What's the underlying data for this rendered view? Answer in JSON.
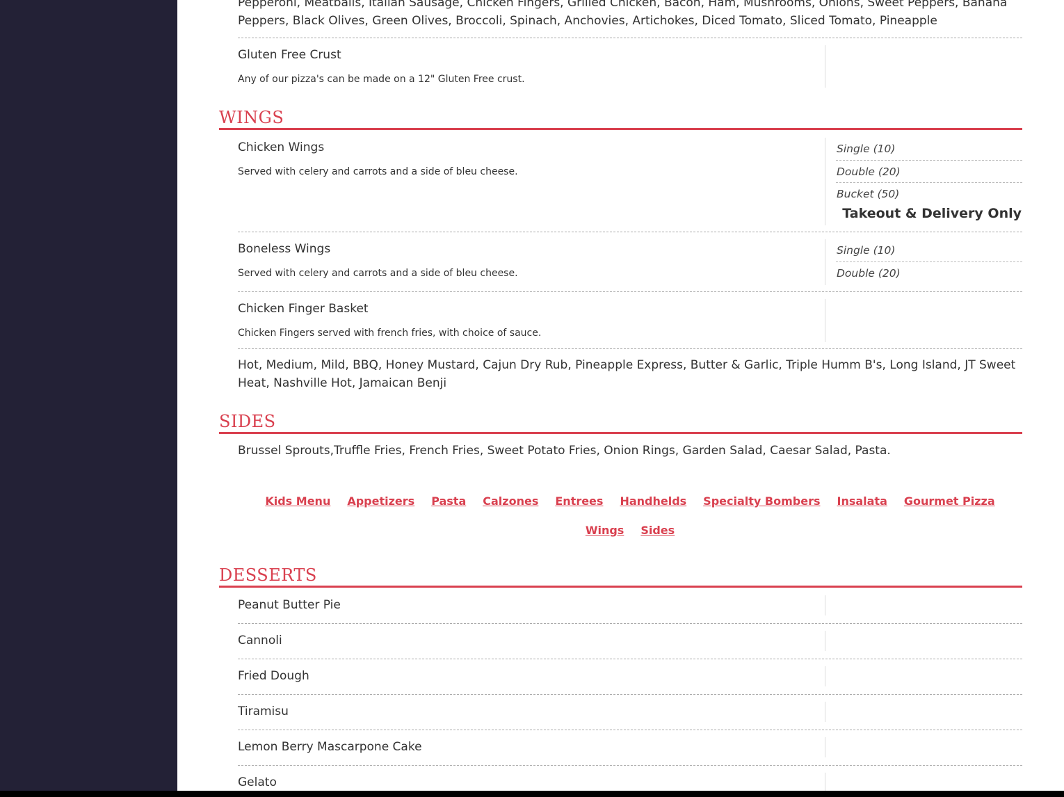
{
  "pizza": {
    "toppings_text": "Pepperoni, Meatballs, Italian Sausage, Chicken Fingers, Grilled Chicken, Bacon, Ham, Mushrooms, Onions, Sweet Peppers, Banana Peppers, Black Olives, Green Olives, Broccoli, Spinach, Anchovies, Artichokes, Diced Tomato, Sliced Tomato, Pineapple",
    "gluten_free": {
      "name": "Gluten Free Crust",
      "description": "Any of our pizza's can be made on a 12\" Gluten Free crust."
    }
  },
  "wings": {
    "title": "WINGS",
    "items": [
      {
        "name": "Chicken Wings",
        "description": "Served with celery and carrots and a side of bleu cheese.",
        "prices": [
          "Single (10)",
          "Double (20)",
          "Bucket (50)"
        ],
        "note": "Takeout & Delivery Only"
      },
      {
        "name": "Boneless Wings",
        "description": "Served with celery and carrots and a side of bleu cheese.",
        "prices": [
          "Single (10)",
          "Double (20)"
        ]
      },
      {
        "name": "Chicken Finger Basket",
        "description": "Chicken Fingers served with french fries, with choice of sauce."
      }
    ],
    "sauces_text": "Hot, Medium, Mild, BBQ, Honey Mustard, Cajun Dry Rub,  Pineapple Express, Butter & Garlic, Triple Humm B's, Long Island, JT Sweet Heat, Nashville Hot, Jamaican Benji"
  },
  "sides": {
    "title": "SIDES",
    "text": "Brussel Sprouts,Truffle Fries, French Fries, Sweet Potato Fries, Onion Rings, Garden Salad, Caesar Salad, Pasta."
  },
  "nav": {
    "row1": [
      "Kids Menu",
      "Appetizers",
      "Pasta",
      "Calzones",
      "Entrees",
      "Handhelds",
      "Specialty Bombers",
      "Insalata",
      "Gourmet Pizza"
    ],
    "row2": [
      "Wings",
      "Sides"
    ]
  },
  "desserts": {
    "title": "DESSERTS",
    "items": [
      "Peanut Butter Pie",
      "Cannoli",
      "Fried Dough",
      "Tiramisu",
      "Lemon Berry Mascarpone Cake",
      "Gelato"
    ]
  },
  "colors": {
    "accent": "#d9404f",
    "sidebar": "#232136"
  }
}
